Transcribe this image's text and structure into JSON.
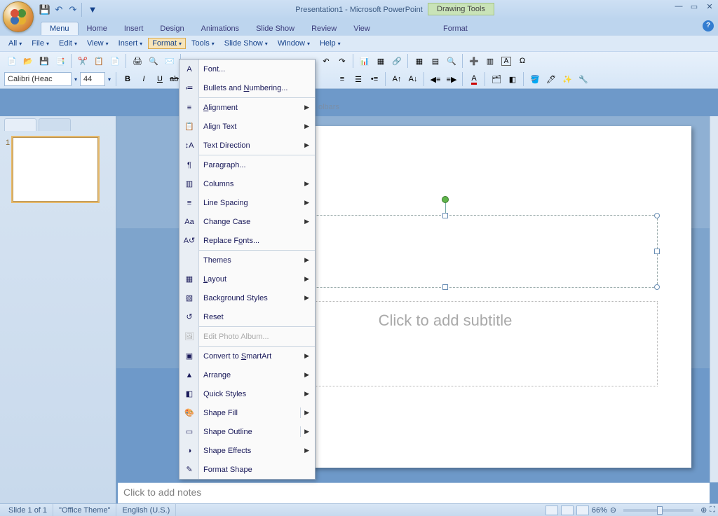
{
  "app": {
    "title": "Presentation1 - Microsoft PowerPoint",
    "context_tab_group": "Drawing Tools"
  },
  "ribbon_tabs": [
    "Menu",
    "Home",
    "Insert",
    "Design",
    "Animations",
    "Slide Show",
    "Review",
    "View"
  ],
  "ribbon_context_tab": "Format",
  "classic_menu": [
    "All",
    "File",
    "Edit",
    "View",
    "Insert",
    "Format",
    "Tools",
    "Slide Show",
    "Window",
    "Help"
  ],
  "classic_menu_open_index": 5,
  "toolbars_hint": "olbars",
  "font": {
    "name": "Calibri (Heac",
    "size": "44"
  },
  "format_menu": [
    {
      "label": "Font...",
      "icon": "A",
      "sub": false
    },
    {
      "label": "Bullets and Numbering...",
      "icon": "≔",
      "sub": false,
      "u": "N"
    },
    {
      "sep": true
    },
    {
      "label": "Alignment",
      "icon": "≡",
      "sub": true,
      "u": "A"
    },
    {
      "label": "Align Text",
      "icon": "📋",
      "sub": true
    },
    {
      "label": "Text Direction",
      "icon": "↕A",
      "sub": true
    },
    {
      "sep": true
    },
    {
      "label": "Paragraph...",
      "icon": "¶"
    },
    {
      "label": "Columns",
      "icon": "▥",
      "sub": true
    },
    {
      "label": "Line Spacing",
      "icon": "≡",
      "sub": true
    },
    {
      "label": "Change Case",
      "icon": "Aa",
      "sub": true
    },
    {
      "label": "Replace Fonts...",
      "icon": "A↺",
      "u": "o"
    },
    {
      "sep": true
    },
    {
      "label": "Themes",
      "icon": "",
      "sub": true
    },
    {
      "label": "Layout",
      "icon": "▦",
      "sub": true,
      "u": "L"
    },
    {
      "label": "Background Styles",
      "icon": "▧",
      "sub": true
    },
    {
      "label": "Reset",
      "icon": "↺"
    },
    {
      "sep": true
    },
    {
      "label": "Edit Photo Album...",
      "icon": "🖼",
      "disabled": true
    },
    {
      "sep": true
    },
    {
      "label": "Convert to SmartArt",
      "icon": "▣",
      "sub": true,
      "u": "S"
    },
    {
      "label": "Arrange",
      "icon": "▲",
      "sub": true
    },
    {
      "label": "Quick Styles",
      "icon": "◧",
      "sub": true
    },
    {
      "label": "Shape Fill",
      "icon": "🎨",
      "sub": true,
      "split": true
    },
    {
      "label": "Shape Outline",
      "icon": "▭",
      "sub": true,
      "split": true
    },
    {
      "label": "Shape Effects",
      "icon": "◑",
      "sub": true
    },
    {
      "label": "Format Shape",
      "icon": "✎"
    }
  ],
  "slide": {
    "subtitle_placeholder": "Click to add subtitle"
  },
  "notes_placeholder": "Click to add notes",
  "status": {
    "slide": "Slide 1 of 1",
    "theme": "\"Office Theme\"",
    "lang": "English (U.S.)",
    "zoom": "66%"
  }
}
